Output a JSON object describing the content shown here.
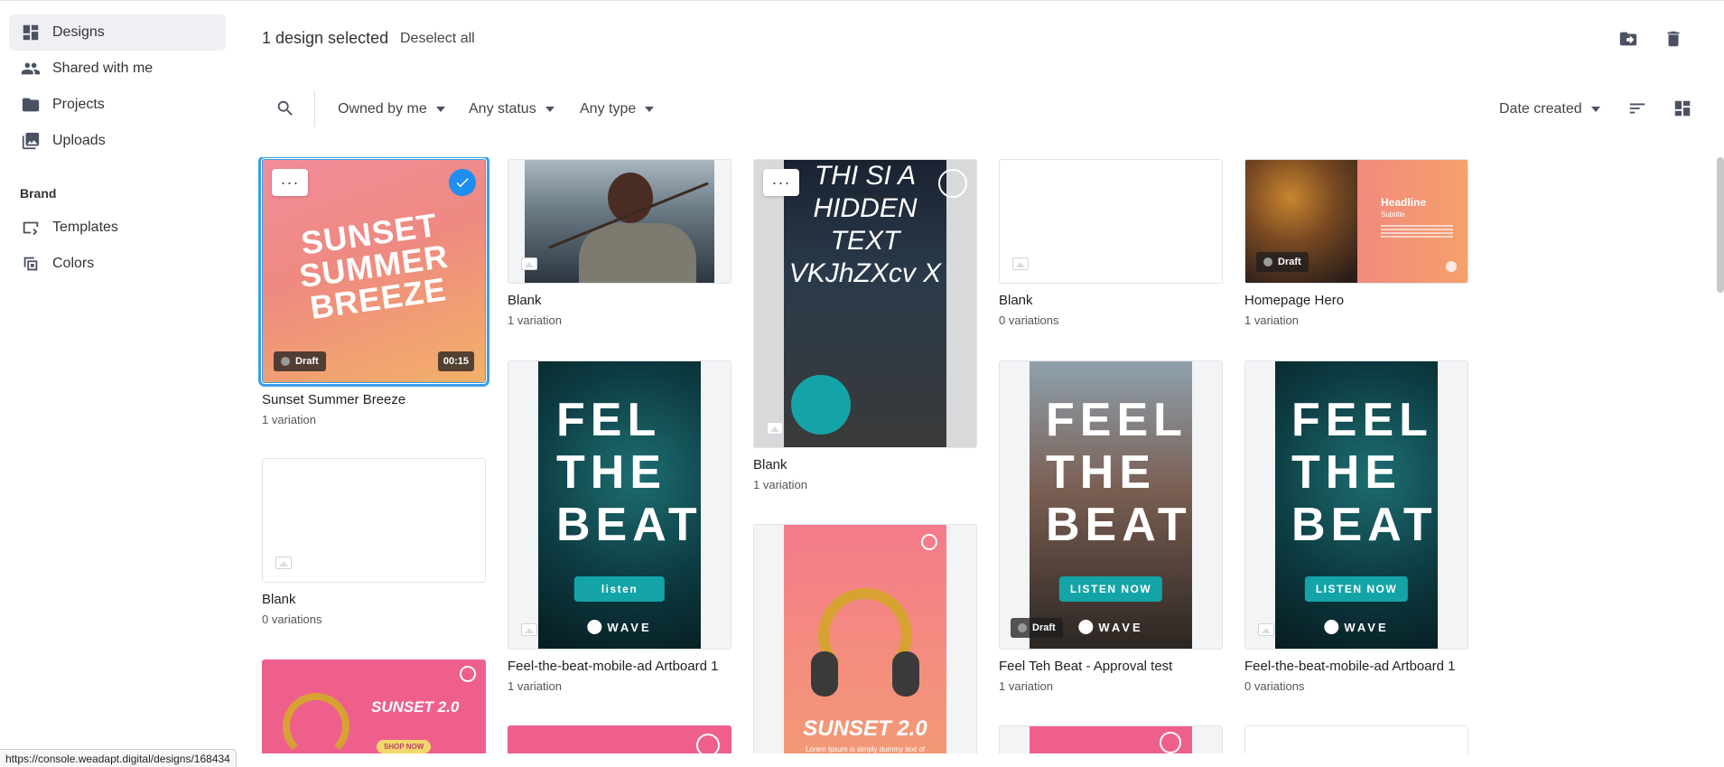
{
  "sidebar": {
    "items": [
      {
        "label": "Designs",
        "icon": "dashboard-icon"
      },
      {
        "label": "Shared with me",
        "icon": "people-icon"
      },
      {
        "label": "Projects",
        "icon": "folder-icon"
      },
      {
        "label": "Uploads",
        "icon": "photo-library-icon"
      }
    ],
    "brand_label": "Brand",
    "brand_items": [
      {
        "label": "Templates",
        "icon": "template-icon"
      },
      {
        "label": "Colors",
        "icon": "palette-icon"
      }
    ]
  },
  "header": {
    "selection_count": "1 design selected",
    "deselect_label": "Deselect all"
  },
  "filters": {
    "owned": "Owned by me",
    "status": "Any status",
    "type": "Any type",
    "sort": "Date created"
  },
  "designs": [
    {
      "title": "Sunset Summer Breeze",
      "sub": "1 variation",
      "badge": "Draft",
      "duration": "00:15",
      "thumb_text": "SUNSET SUMMER BREEZE",
      "more": "···"
    },
    {
      "title": "Blank",
      "sub": "0 variations"
    },
    {
      "title": "Blank",
      "sub": "1 variation"
    },
    {
      "title": "Feel-the-beat-mobile-ad Artboard 1",
      "sub": "1 variation",
      "headline": "FEL THE BEAT",
      "button": "listen",
      "brand": "WAVE"
    },
    {
      "title": "Blank",
      "sub": "1 variation",
      "hidden_text": "THI SI A HIDDEN TEXT VKJhZXcv X",
      "more": "···"
    },
    {
      "title": "Blank",
      "sub": "0 variations"
    },
    {
      "title": "Feel Teh Beat - Approval test",
      "sub": "1 variation",
      "badge": "Draft",
      "headline": "FEEL THE BEAT",
      "button": "LISTEN NOW",
      "brand": "WAVE"
    },
    {
      "title": "Homepage Hero",
      "sub": "1 variation",
      "badge": "Draft",
      "hero_headline": "Headline",
      "hero_subtitle": "Subtitle"
    },
    {
      "title": "Feel-the-beat-mobile-ad Artboard 1",
      "sub": "0 variations",
      "headline": "FEEL THE BEAT",
      "button": "LISTEN NOW",
      "brand": "WAVE"
    },
    {
      "title": "",
      "sub": "",
      "thumb_text": "SUNSET 2.0",
      "button": "SHOP NOW"
    },
    {
      "title": "",
      "sub": "",
      "thumb_text": "SUNSET 2.0",
      "small": "Lorem Ipsum is simply dummy text of the printing and typesetting industry."
    }
  ],
  "status_url": "https://console.weadapt.digital/designs/168434",
  "colors": {
    "accent": "#1e8ef1",
    "teal": "#14a4a7",
    "sidebar_active": "#eef0f3"
  }
}
